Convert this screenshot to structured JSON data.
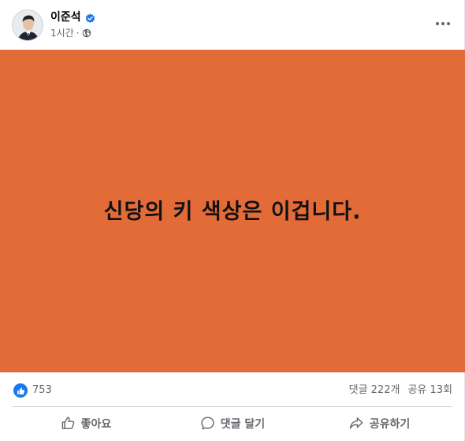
{
  "post": {
    "author": {
      "name": "이준석",
      "verified": true
    },
    "meta": {
      "time": "1시간",
      "separator": "·",
      "audience_icon": "globe-icon"
    },
    "more_icon": "more-options-icon",
    "media": {
      "background_color": "#E36B38",
      "text": "신당의 키 색상은 이겁니다.",
      "text_color": "#111111"
    },
    "stats": {
      "reaction_icon": "like-reaction-icon",
      "reaction_count": "753",
      "comments": "댓글 222개",
      "shares": "공유 13회"
    },
    "actions": {
      "like": {
        "label": "좋아요",
        "icon": "thumbs-up-icon"
      },
      "comment": {
        "label": "댓글 달기",
        "icon": "comment-bubble-icon"
      },
      "share": {
        "label": "공유하기",
        "icon": "share-arrow-icon"
      }
    },
    "colors": {
      "accent": "#1877F2",
      "muted_text": "#65676B",
      "divider": "#CED0D4"
    }
  }
}
